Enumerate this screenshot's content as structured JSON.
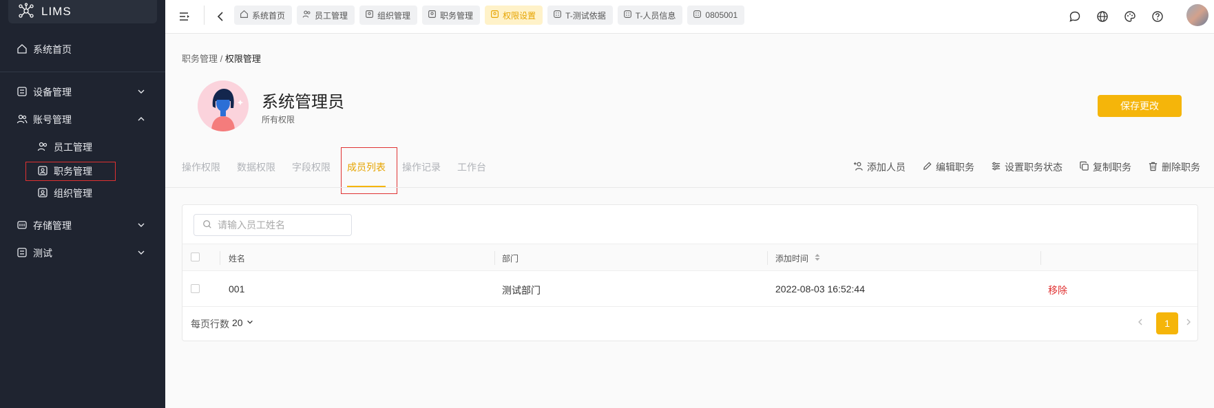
{
  "app": {
    "name": "LIMS"
  },
  "sidebar": {
    "home": "系统首页",
    "items": [
      {
        "label": "设备管理"
      },
      {
        "label": "账号管理"
      },
      {
        "label": "存储管理"
      },
      {
        "label": "测试"
      }
    ],
    "sub_items": [
      {
        "label": "员工管理"
      },
      {
        "label": "职务管理"
      },
      {
        "label": "组织管理"
      }
    ]
  },
  "topbar": {
    "tabs": [
      {
        "label": "系统首页"
      },
      {
        "label": "员工管理"
      },
      {
        "label": "组织管理"
      },
      {
        "label": "职务管理"
      },
      {
        "label": "权限设置"
      },
      {
        "label": "T-测试依据"
      },
      {
        "label": "T-人员信息"
      },
      {
        "label": "0805001"
      }
    ]
  },
  "breadcrumb": {
    "parent": "职务管理",
    "separator": " / ",
    "current": "权限管理"
  },
  "role": {
    "title": "系统管理员",
    "subtitle": "所有权限"
  },
  "save_label": "保存更改",
  "page_tabs": [
    {
      "label": "操作权限"
    },
    {
      "label": "数据权限"
    },
    {
      "label": "字段权限"
    },
    {
      "label": "成员列表"
    },
    {
      "label": "操作记录"
    },
    {
      "label": "工作台"
    }
  ],
  "actions": [
    {
      "label": "添加人员"
    },
    {
      "label": "编辑职务"
    },
    {
      "label": "设置职务状态"
    },
    {
      "label": "复制职务"
    },
    {
      "label": "删除职务"
    }
  ],
  "search": {
    "placeholder": "请输入员工姓名"
  },
  "table": {
    "headers": {
      "name": "姓名",
      "dept": "部门",
      "time": "添加时间"
    },
    "rows": [
      {
        "name": "001",
        "dept": "测试部门",
        "time": "2022-08-03 16:52:44",
        "action": "移除"
      }
    ]
  },
  "pagination": {
    "rows_label": "每页行数",
    "rows_value": "20",
    "current_page": "1"
  },
  "colors": {
    "accent": "#f5b50a",
    "sidebar_bg": "#1f2430",
    "danger": "#e03131"
  }
}
